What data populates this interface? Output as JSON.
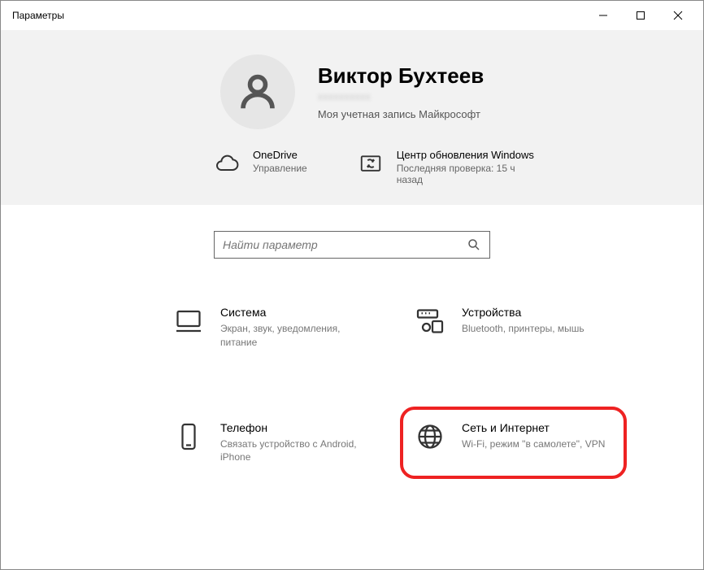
{
  "window": {
    "title": "Параметры"
  },
  "profile": {
    "name": "Виктор Бухтеев",
    "account_link": "Моя учетная запись Майкрософт"
  },
  "quick": {
    "onedrive": {
      "title": "OneDrive",
      "sub": "Управление"
    },
    "update": {
      "title": "Центр обновления Windows",
      "sub": "Последняя проверка: 15 ч назад"
    }
  },
  "search": {
    "placeholder": "Найти параметр"
  },
  "categories": {
    "system": {
      "title": "Система",
      "sub": "Экран, звук, уведомления, питание"
    },
    "devices": {
      "title": "Устройства",
      "sub": "Bluetooth, принтеры, мышь"
    },
    "phone": {
      "title": "Телефон",
      "sub": "Связать устройство с Android, iPhone"
    },
    "network": {
      "title": "Сеть и Интернет",
      "sub": "Wi-Fi, режим \"в самолете\", VPN"
    }
  }
}
